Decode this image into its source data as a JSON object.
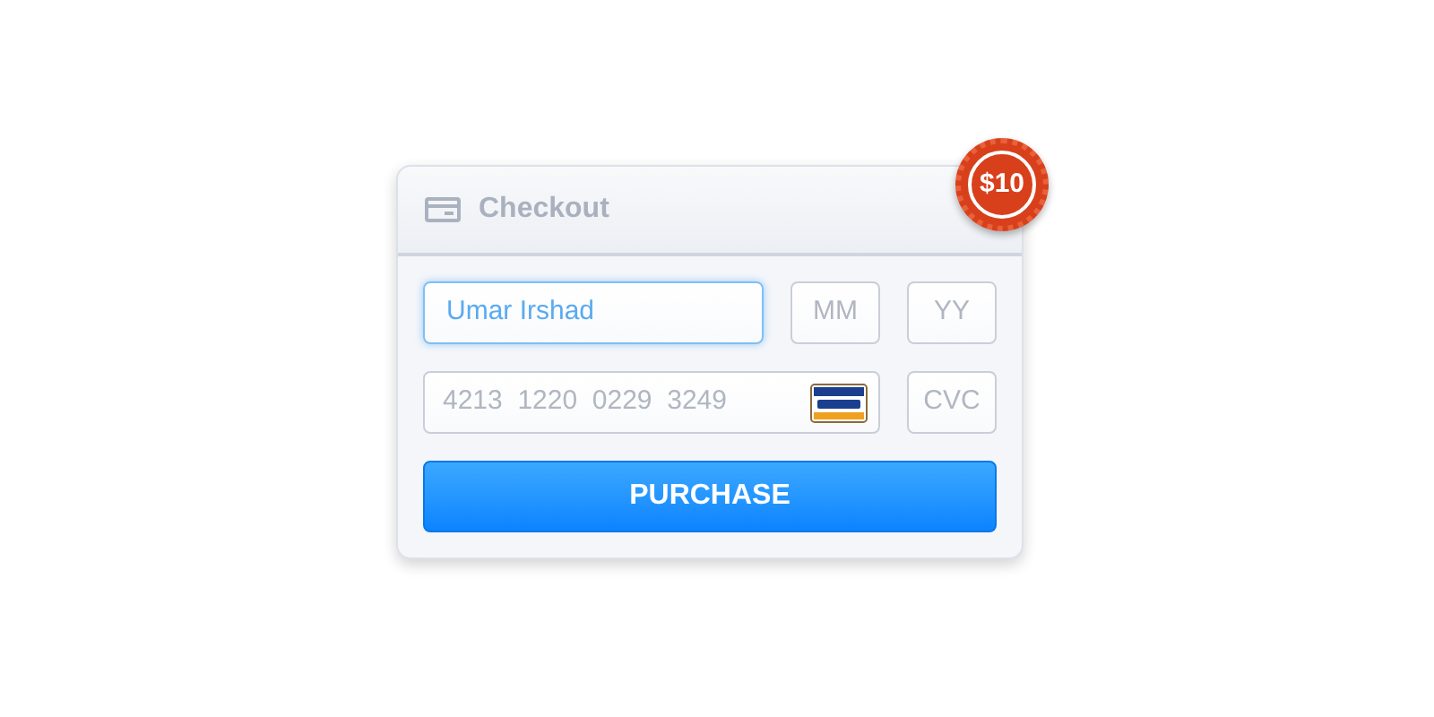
{
  "card": {
    "title": "Checkout",
    "badge": "$10"
  },
  "fields": [
    {
      "kind": "name",
      "value": "Umar Irshad",
      "focused": true
    },
    {
      "kind": "month",
      "placeholder": "MM",
      "focused": false
    },
    {
      "kind": "year",
      "placeholder": "YY",
      "focused": false
    },
    {
      "kind": "number",
      "placeholder": "4213  1220  0229  3249",
      "focused": false
    },
    {
      "kind": "cvc",
      "placeholder": "CVC",
      "focused": false
    }
  ],
  "button": {
    "label": "PURCHASE"
  }
}
